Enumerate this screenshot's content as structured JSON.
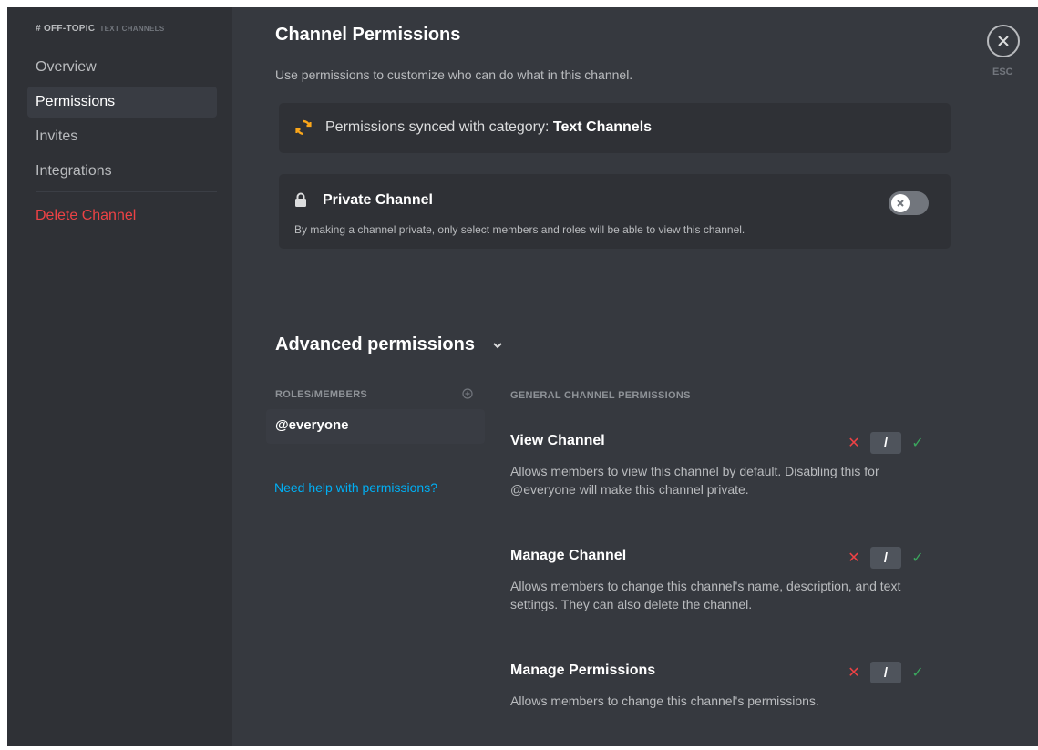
{
  "sidebar": {
    "channel": "# OFF-TOPIC",
    "category": "TEXT CHANNELS",
    "items": [
      {
        "label": "Overview"
      },
      {
        "label": "Permissions"
      },
      {
        "label": "Invites"
      },
      {
        "label": "Integrations"
      }
    ],
    "delete_label": "Delete Channel"
  },
  "header": {
    "title": "Channel Permissions",
    "description": "Use permissions to customize who can do what in this channel."
  },
  "sync": {
    "text": "Permissions synced with category: ",
    "category": "Text Channels"
  },
  "private_channel": {
    "title": "Private Channel",
    "description": "By making a channel private, only select members and roles will be able to view this channel.",
    "enabled": false
  },
  "advanced": {
    "title": "Advanced permissions",
    "roles_header": "ROLES/MEMBERS",
    "roles": [
      {
        "name": "@everyone",
        "selected": true
      }
    ],
    "help_link": "Need help with permissions?",
    "perm_header": "GENERAL CHANNEL PERMISSIONS",
    "permissions": [
      {
        "name": "View Channel",
        "description": "Allows members to view this channel by default. Disabling this for @everyone will make this channel private.",
        "state": "neutral"
      },
      {
        "name": "Manage Channel",
        "description": "Allows members to change this channel's name, description, and text settings. They can also delete the channel.",
        "state": "neutral"
      },
      {
        "name": "Manage Permissions",
        "description": "Allows members to change this channel's permissions.",
        "state": "neutral"
      }
    ],
    "tri_symbols": {
      "deny": "✕",
      "neutral": "/",
      "allow": "✓"
    }
  },
  "close": {
    "label": "ESC"
  },
  "colors": {
    "background": "#36393f",
    "sidebar": "#2f3136",
    "danger": "#ed4245",
    "link": "#00aff4",
    "allow": "#3ba55d",
    "sync_icon": "#faa61a"
  },
  "icons": [
    "sync-icon",
    "lock-icon",
    "close-x-icon",
    "chevron-down-icon",
    "add-circle-icon"
  ]
}
